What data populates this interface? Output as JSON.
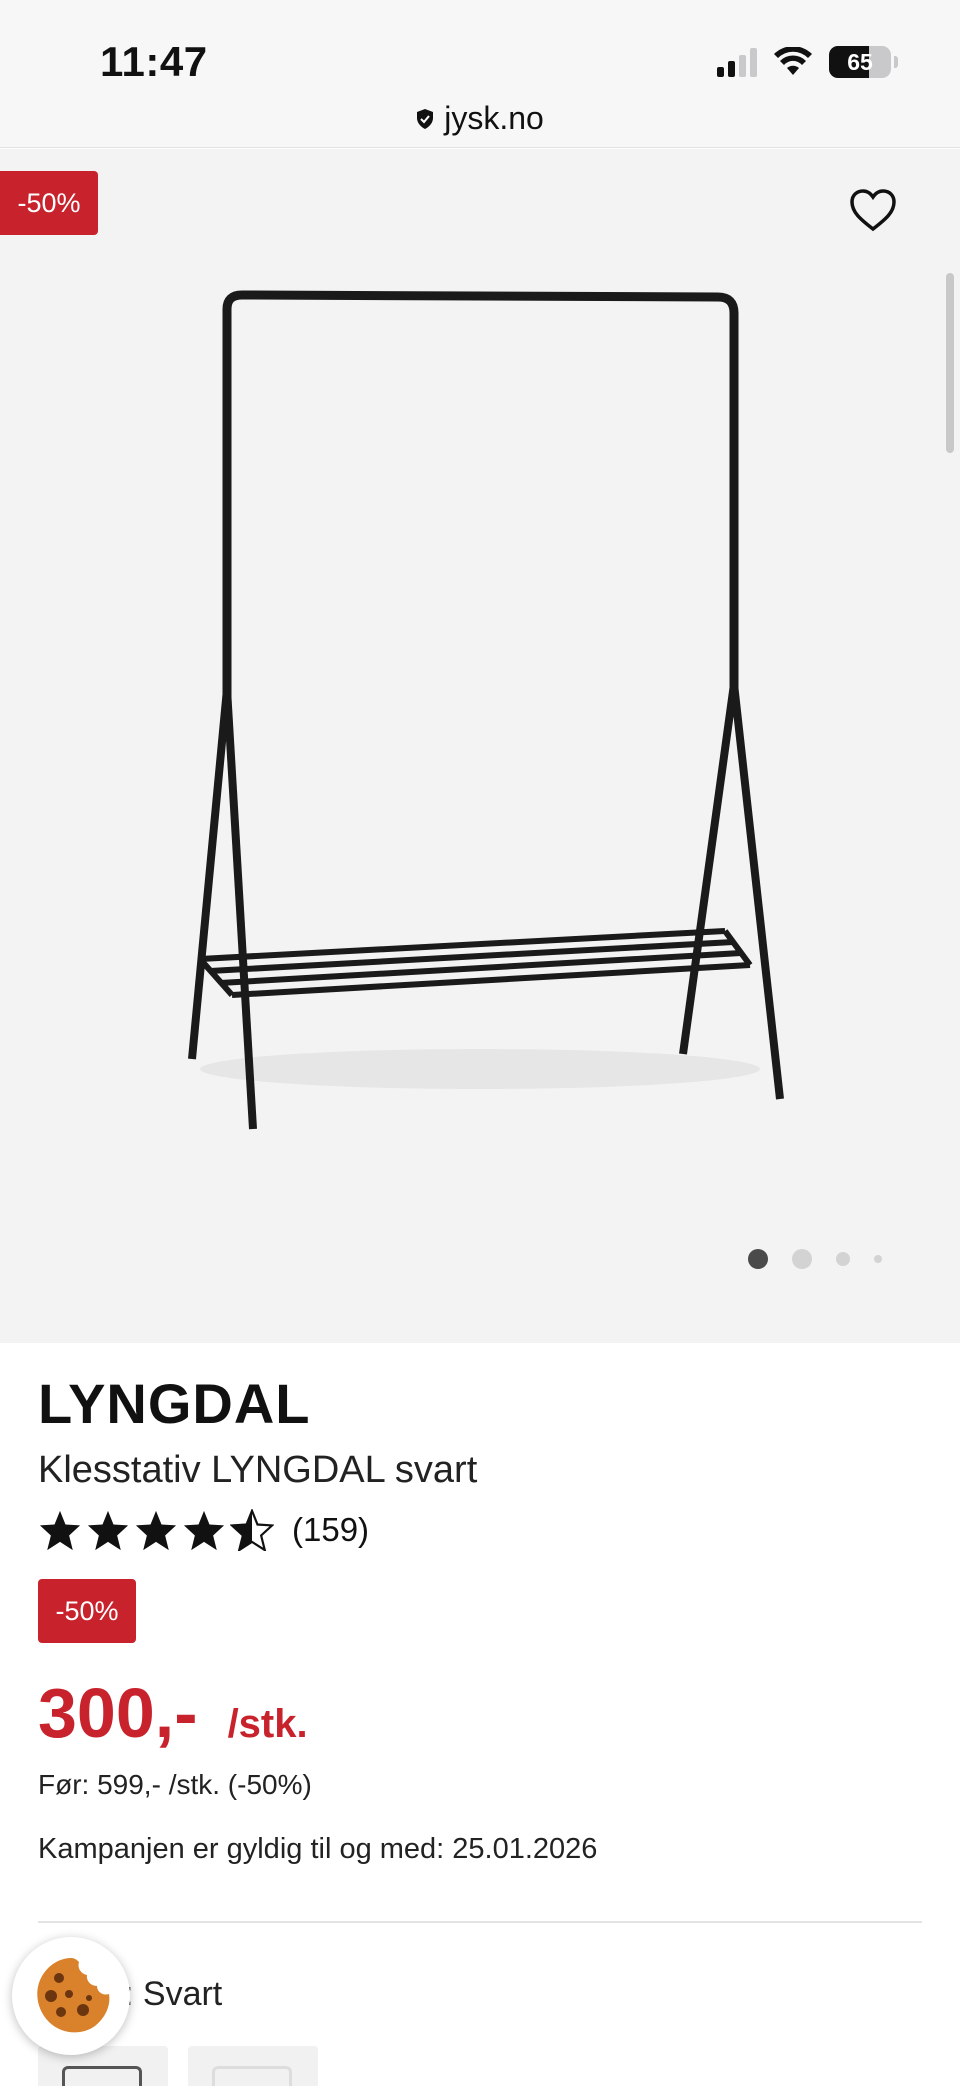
{
  "status_bar": {
    "time": "11:47",
    "battery": "65",
    "battery_level": 0.65,
    "signal_bars_active": 2
  },
  "url_bar": {
    "domain": "jysk.no",
    "icon": "shield-icon"
  },
  "gallery": {
    "discount_badge": "-50%",
    "favorite_icon": "heart-outline-icon",
    "image_count": 4,
    "active_index": 0
  },
  "product": {
    "brand": "LYNGDAL",
    "name": "Klesstativ LYNGDAL svart",
    "rating": 4.5,
    "rating_max": 5,
    "rating_count": "(159)",
    "discount_badge": "-50%",
    "price": "300,-",
    "price_unit": "/stk.",
    "price_before": "Før: 599,- /stk. (-50%)",
    "campaign": "Kampanjen er gyldig til og med: 25.01.2026",
    "color_value": ": Svart"
  },
  "colors": {
    "accent": "#c8232c",
    "gallery_bg": "#f3f3f3"
  }
}
